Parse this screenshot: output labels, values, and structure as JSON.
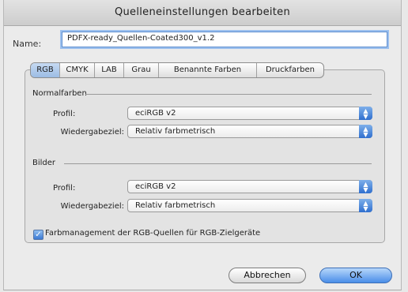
{
  "window": {
    "title": "Quelleneinstellungen bearbeiten"
  },
  "name": {
    "label": "Name:",
    "value": "PDFX-ready_Quellen-Coated300_v1.2"
  },
  "tabs": [
    {
      "label": "RGB",
      "active": true
    },
    {
      "label": "CMYK",
      "active": false
    },
    {
      "label": "LAB",
      "active": false
    },
    {
      "label": "Grau",
      "active": false
    },
    {
      "label": "Benannte Farben",
      "active": false
    },
    {
      "label": "Druckfarben",
      "active": false
    }
  ],
  "normalfarben": {
    "title": "Normalfarben",
    "profil_label": "Profil:",
    "profil_value": "eciRGB v2",
    "intent_label": "Wiedergabeziel:",
    "intent_value": "Relativ farbmetrisch"
  },
  "bilder": {
    "title": "Bilder",
    "profil_label": "Profil:",
    "profil_value": "eciRGB v2",
    "intent_label": "Wiedergabeziel:",
    "intent_value": "Relativ farbmetrisch"
  },
  "checkbox": {
    "label": "Farbmanagement der RGB-Quellen für RGB-Zielgeräte",
    "checked": true
  },
  "buttons": {
    "cancel": "Abbrechen",
    "ok": "OK"
  },
  "icons": {
    "select_arrows": "updown-arrows-icon",
    "checkmark": "checkmark-icon"
  },
  "colors": {
    "accent": "#3b79d3",
    "focus_ring": "#9cc0ee"
  }
}
